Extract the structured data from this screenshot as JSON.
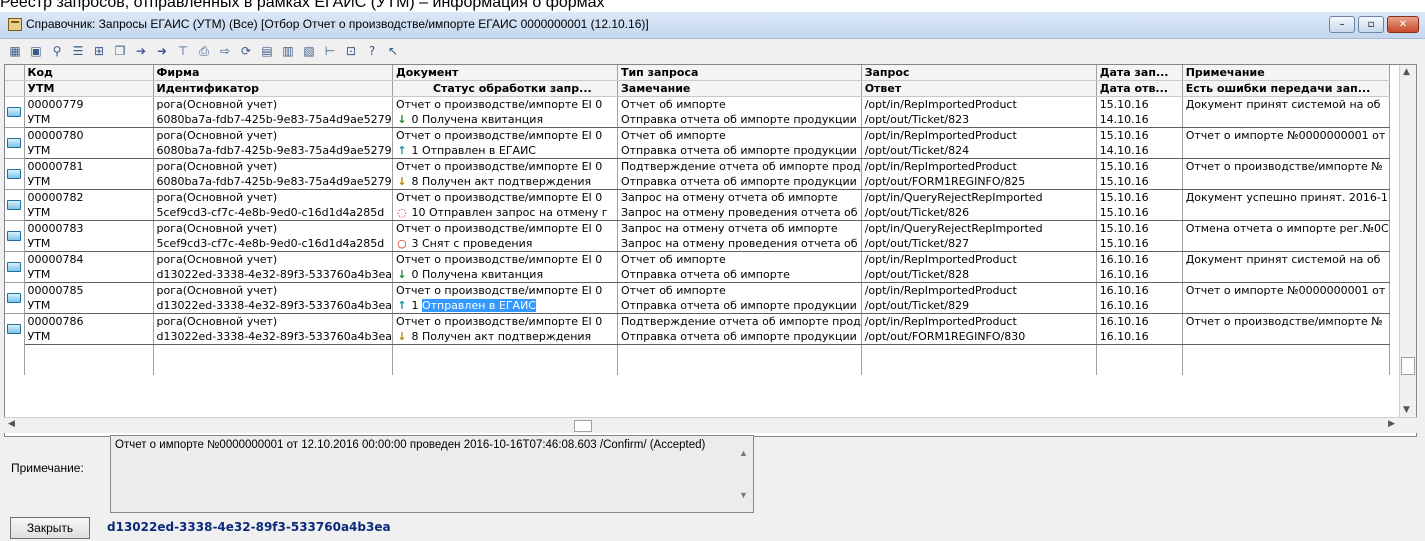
{
  "header_line": "Реестр запросов, отправленных в рамках ЕГАИС (УТМ) – информация о формах",
  "window": {
    "title": "Справочник: Запросы ЕГАИС (УТМ) (Все) [Отбор Отчет о производстве/импорте ЕГАИС 0000000001 (12.10.16)]",
    "buttons": [
      "–",
      "▫",
      "✕"
    ]
  },
  "toolbar": {
    "icons": [
      "calendar-icon",
      "grid-icon",
      "search-icon",
      "list-icon",
      "filter-icon",
      "copy-icon",
      "export-icon",
      "import-icon",
      "column-icon",
      "print-icon",
      "move-icon",
      "refresh-icon",
      "doc-icon",
      "copy-doc-icon",
      "paste-icon",
      "tree-icon",
      "structure-icon",
      "help-icon",
      "pointer-help-icon"
    ]
  },
  "grid": {
    "headers_row1": [
      "Код",
      "Фирма",
      "Документ",
      "Тип запроса",
      "Запрос",
      "Дата зап...",
      "Примечание"
    ],
    "headers_row2": [
      "УТМ",
      "Идентификатор",
      "Статус обработки запр...",
      "Замечание",
      "Ответ",
      "Дата отв...",
      "Есть ошибки передачи зап..."
    ],
    "records": [
      {
        "code": "00000779",
        "firm": "рога(Основной учет)",
        "doc": "Отчет о производстве/импорте ЕІ 0",
        "type": "Отчет об импорте",
        "request": "/opt/in/RepImportedProduct",
        "date_req": "15.10.16",
        "note": "Документ принят системой на об",
        "utm": "УТМ",
        "guid": "6080ba7a-fdb7-425b-9e83-75a4d9ae5279",
        "status_icon": "↓",
        "status_color": "#1b8a2e",
        "status_code": "0",
        "status_text": "Получена квитанция",
        "remark": "Отправка отчета об импорте продукции",
        "answer": "/opt/out/Ticket/823",
        "date_ans": "14.10.16",
        "errors": ""
      },
      {
        "code": "00000780",
        "firm": "рога(Основной учет)",
        "doc": "Отчет о производстве/импорте ЕІ 0",
        "type": "Отчет об импорте",
        "request": "/opt/in/RepImportedProduct",
        "date_req": "15.10.16",
        "note": "Отчет о импорте №0000000001 от",
        "utm": "УТМ",
        "guid": "6080ba7a-fdb7-425b-9e83-75a4d9ae5279",
        "status_icon": "↑",
        "status_color": "#1f8fa0",
        "status_code": "1",
        "status_text": "Отправлен в ЕГАИС",
        "remark": "Отправка отчета об импорте продукции",
        "answer": "/opt/out/Ticket/824",
        "date_ans": "14.10.16",
        "errors": ""
      },
      {
        "code": "00000781",
        "firm": "рога(Основной учет)",
        "doc": "Отчет о производстве/импорте ЕІ 0",
        "type": "Подтверждение отчета об импорте прод",
        "request": "/opt/in/RepImportedProduct",
        "date_req": "15.10.16",
        "note": "Отчет о производстве/импорте №",
        "utm": "УТМ",
        "guid": "6080ba7a-fdb7-425b-9e83-75a4d9ae5279",
        "status_icon": "↓",
        "status_color": "#b58a00",
        "status_code": "8",
        "status_text": "Получен акт подтверждения",
        "remark": "Отправка отчета об импорте продукции",
        "answer": "/opt/out/FORM1REGINFO/825",
        "date_ans": "15.10.16",
        "errors": ""
      },
      {
        "code": "00000782",
        "firm": "рога(Основной учет)",
        "doc": "Отчет о производстве/импорте ЕІ 0",
        "type": "Запрос на отмену отчета об импорте",
        "request": "/opt/in/QueryRejectRepImported",
        "date_req": "15.10.16",
        "note": "Документ успешно принят. 2016-1",
        "utm": "УТМ",
        "guid": "5cef9cd3-cf7c-4e8b-9ed0-c16d1d4a285d",
        "status_icon": "◌",
        "status_color": "#d01818",
        "status_code": "10",
        "status_text": "Отправлен запрос на отмену г",
        "remark": "Запрос на отмену проведения отчета об",
        "answer": "/opt/out/Ticket/826",
        "date_ans": "15.10.16",
        "errors": ""
      },
      {
        "code": "00000783",
        "firm": "рога(Основной учет)",
        "doc": "Отчет о производстве/импорте ЕІ 0",
        "type": "Запрос на отмену отчета об импорте",
        "request": "/opt/in/QueryRejectRepImported",
        "date_req": "15.10.16",
        "note": "Отмена отчета о импорте рег.№0С",
        "utm": "УТМ",
        "guid": "5cef9cd3-cf7c-4e8b-9ed0-c16d1d4a285d",
        "status_icon": "○",
        "status_color": "#d01818",
        "status_code": "3",
        "status_text": "Снят с проведения",
        "remark": "Запрос на отмену проведения отчета об",
        "answer": "/opt/out/Ticket/827",
        "date_ans": "15.10.16",
        "errors": ""
      },
      {
        "code": "00000784",
        "firm": "рога(Основной учет)",
        "doc": "Отчет о производстве/импорте ЕІ 0",
        "type": "Отчет об импорте",
        "request": "/opt/in/RepImportedProduct",
        "date_req": "16.10.16",
        "note": "Документ принят системой на об",
        "utm": "УТМ",
        "guid": "d13022ed-3338-4e32-89f3-533760a4b3ea",
        "status_icon": "↓",
        "status_color": "#1b8a2e",
        "status_code": "0",
        "status_text": "Получена квитанция",
        "remark": "Отправка отчета об импорте",
        "answer": "/opt/out/Ticket/828",
        "date_ans": "16.10.16",
        "errors": ""
      },
      {
        "code": "00000785",
        "firm": "рога(Основной учет)",
        "doc": "Отчет о производстве/импорте ЕІ 0",
        "type": "Отчет об импорте",
        "request": "/opt/in/RepImportedProduct",
        "date_req": "16.10.16",
        "note": "Отчет о импорте №0000000001 от",
        "utm": "УТМ",
        "guid": "d13022ed-3338-4e32-89f3-533760a4b3ea",
        "status_icon": "↑",
        "status_color": "#1f8fa0",
        "status_code": "1",
        "status_text": "Отправлен в ЕГАИС",
        "remark": "Отправка отчета об импорте продукции",
        "answer": "/opt/out/Ticket/829",
        "date_ans": "16.10.16",
        "errors": ""
      },
      {
        "code": "00000786",
        "firm": "рога(Основной учет)",
        "doc": "Отчет о производстве/импорте ЕІ 0",
        "type": "Подтверждение отчета об импорте прод",
        "request": "/opt/in/RepImportedProduct",
        "date_req": "16.10.16",
        "note": "Отчет о производстве/импорте №",
        "utm": "УТМ",
        "guid": "d13022ed-3338-4e32-89f3-533760a4b3ea",
        "status_icon": "↓",
        "status_color": "#b58a00",
        "status_code": "8",
        "status_text": "Получен акт подтверждения",
        "remark": "Отправка отчета об импорте продукции",
        "answer": "/opt/out/FORM1REGINFO/830",
        "date_ans": "16.10.16",
        "errors": ""
      }
    ]
  },
  "note": {
    "label": "Примечание:",
    "text": "Отчет о импорте №0000000001 от 12.10.2016 00:00:00 проведен 2016-10-16T07:46:08.603 /Confirm/ (Accepted)"
  },
  "footer": {
    "close_label": "Закрыть",
    "guid": "d13022ed-3338-4e32-89f3-533760a4b3ea"
  }
}
